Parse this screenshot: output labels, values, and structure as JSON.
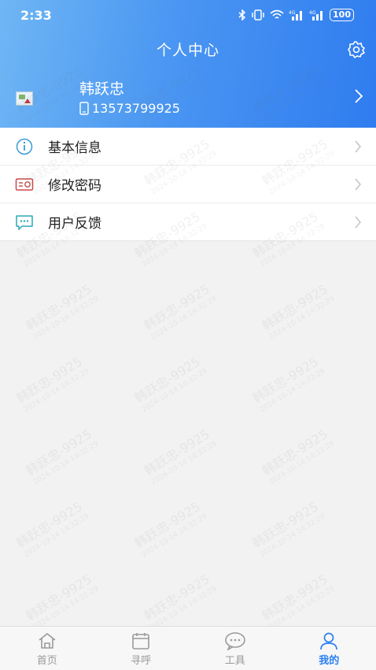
{
  "status_bar": {
    "time": "2:33",
    "icons": [
      "bluetooth-icon",
      "vibrate-icon",
      "wifi-icon",
      "signal-icon",
      "signal-icon"
    ],
    "battery": "100"
  },
  "header": {
    "title": "个人中心",
    "settings_icon": "gear-icon"
  },
  "profile": {
    "name": "韩跃忠",
    "phone": "13573799925"
  },
  "menu": [
    {
      "label": "基本信息",
      "icon": "info-icon"
    },
    {
      "label": "修改密码",
      "icon": "password-icon"
    },
    {
      "label": "用户反馈",
      "icon": "feedback-icon"
    }
  ],
  "tabs": [
    {
      "label": "首页",
      "icon": "home-icon",
      "active": false
    },
    {
      "label": "寻呼",
      "icon": "calendar-icon",
      "active": false
    },
    {
      "label": "工具",
      "icon": "chat-icon",
      "active": false
    },
    {
      "label": "我的",
      "icon": "user-icon",
      "active": true
    }
  ],
  "watermark": {
    "name": "韩跃忠-9925",
    "timestamp": "2024-10-14 14:32:29"
  },
  "colors": {
    "accent": "#2c80ef",
    "header_start": "#6fb6f4",
    "header_end": "#2f7cf0"
  }
}
